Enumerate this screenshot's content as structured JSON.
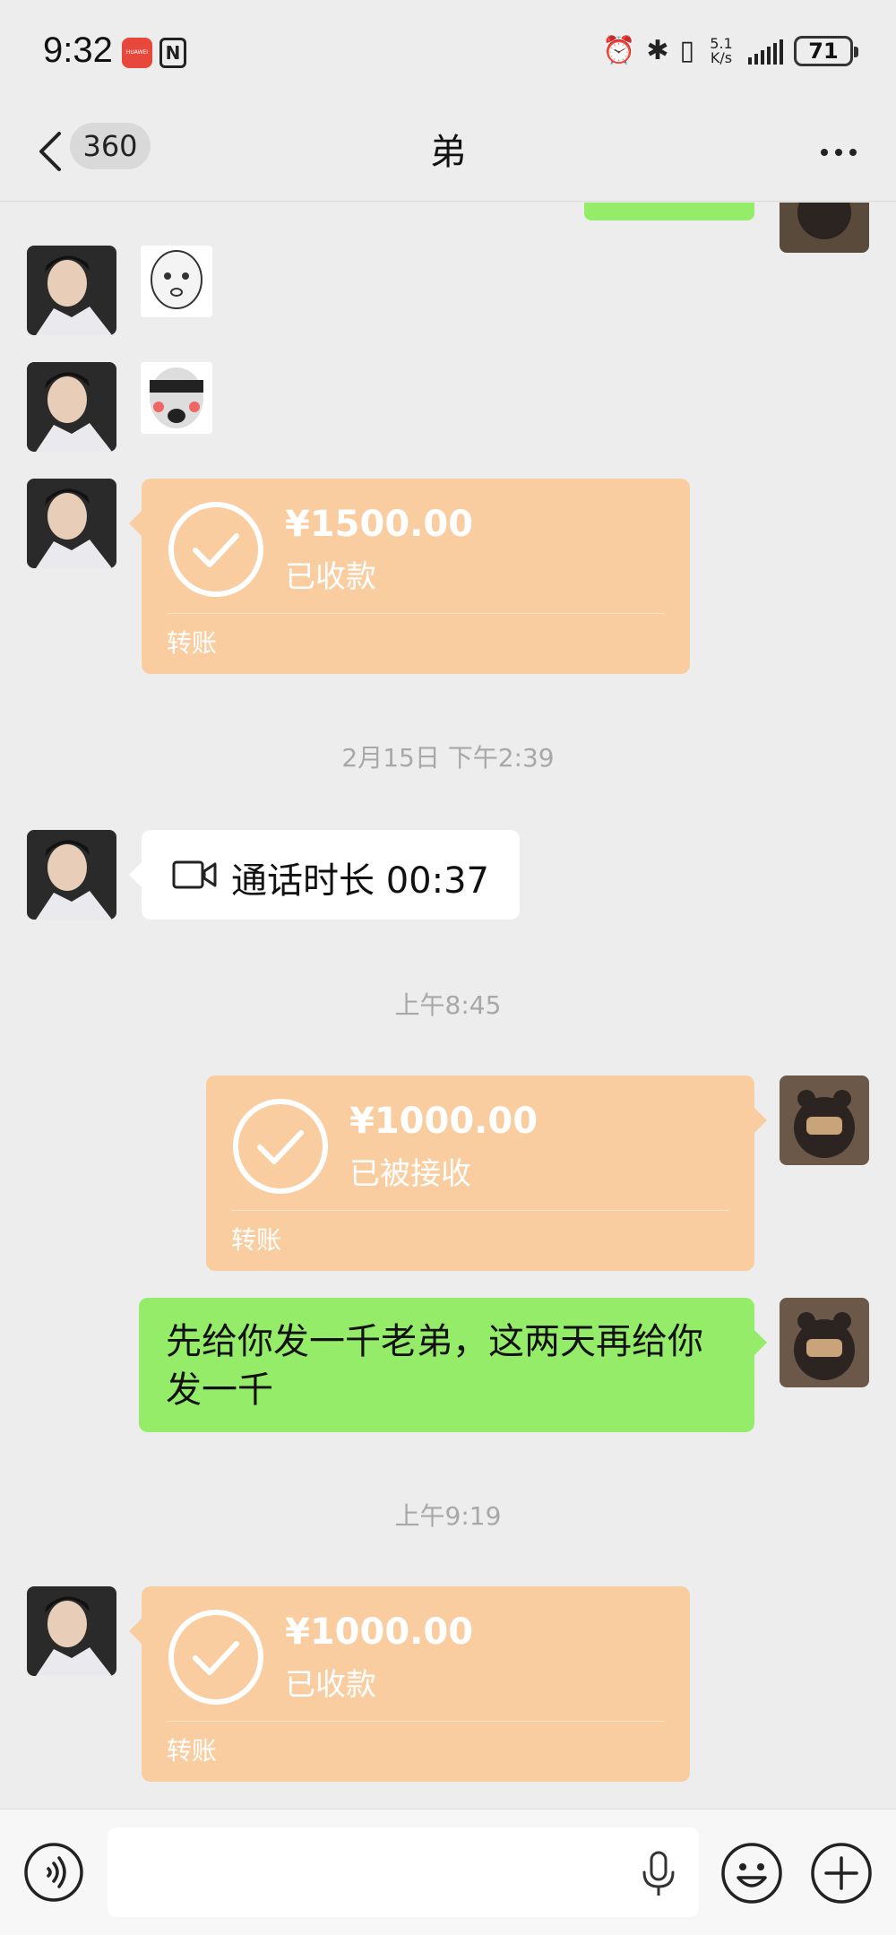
{
  "status_bar": {
    "time": "9:32",
    "huawei_badge": "HUAWEI",
    "nfc": "N",
    "net_speed_value": "5.1",
    "net_speed_unit": "K/s",
    "battery": "71"
  },
  "header": {
    "unread_count": "360",
    "title": "弟"
  },
  "messages": {
    "transfer1": {
      "amount": "¥1500.00",
      "status": "已收款",
      "label": "转账"
    },
    "timestamp1": "2月15日 下午2:39",
    "call": {
      "text": "通话时长 00:37"
    },
    "timestamp2": "上午8:45",
    "transfer2": {
      "amount": "¥1000.00",
      "status": "已被接收",
      "label": "转账"
    },
    "text1": "先给你发一千老弟，这两天再给你发一千",
    "timestamp3": "上午9:19",
    "transfer3": {
      "amount": "¥1000.00",
      "status": "已收款",
      "label": "转账"
    }
  },
  "colors": {
    "transfer_bg": "#f9cd9f",
    "sent_bubble": "#95ec69",
    "background": "#ededed"
  },
  "icons": [
    "back-icon",
    "more-icon",
    "check-circle-icon",
    "video-call-icon",
    "voice-icon",
    "mic-icon",
    "emoji-icon",
    "plus-icon"
  ]
}
